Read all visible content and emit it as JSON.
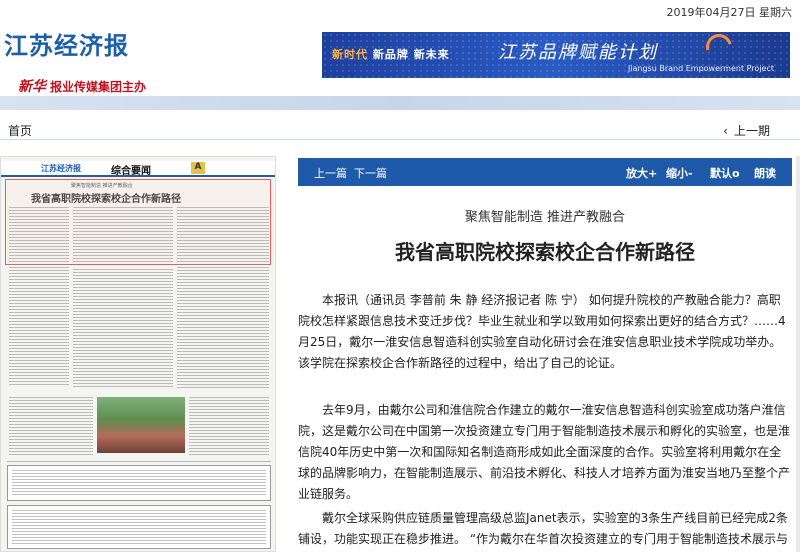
{
  "header": {
    "date": "2019年04月27日 星期六",
    "site_title": "江苏经济报",
    "publisher_logo": "新华",
    "publisher_text": "报业传媒集团主办",
    "banner": {
      "slogan_1": "新时代",
      "slogan_2": "新品牌",
      "slogan_3": "新未来",
      "title": "江苏品牌赋能计划",
      "subtitle": "Jiangsu Brand Empowerment Project"
    }
  },
  "nav": {
    "home": "首页",
    "prev_edition": "上一期",
    "prev_icon": "chevron-left-icon"
  },
  "thumbnail": {
    "paper_name": "江苏经济报",
    "section": "综合要闻",
    "badge": "A",
    "kicker": "聚焦智能制造 推进产教融合",
    "headline": "我省高职院校探索校企合作新路径"
  },
  "toolbar": {
    "prev_article": "上一篇",
    "next_article": "下一篇",
    "zoom_in": "放大+",
    "zoom_out": "缩小-",
    "default_size": "默认o",
    "read_aloud": "朗读"
  },
  "article": {
    "kicker": "聚焦智能制造 推进产教融合",
    "headline": "我省高职院校探索校企合作新路径",
    "paragraphs": [
      "本报讯（通讯员 李普前 朱 静 经济报记者 陈 宁） 如何提升院校的产教融合能力？高职院校怎样紧跟信息技术变迁步伐？毕业生就业和学以致用如何探索出更好的结合方式？……4月25日，戴尔一淮安信息智造科创实验室自动化研讨会在淮安信息职业技术学院成功举办。该学院在探索校企合作新路径的过程中，给出了自己的论证。",
      "去年9月，由戴尔公司和淮信院合作建立的戴尔一淮安信息智造科创实验室成功落户淮信院，这是戴尔公司在中国第一次投资建立专门用于智能制造技术展示和孵化的实验室，也是淮信院40年历史中第一次和国际知名制造商形成如此全面深度的合作。实验室将利用戴尔在全球的品牌影响力，在智能制造展示、前沿技术孵化、科技人才培养方面为淮安当地乃至整个产业链服务。",
      "戴尔全球采购供应链质量管理高级总监Janet表示，实验室的3条生产线目前已经完成2条铺设，功能实现正在稳步推进。 “作为戴尔在华首次投资建立的专门用于智能制造技术展示与孵化的创新平"
    ]
  }
}
